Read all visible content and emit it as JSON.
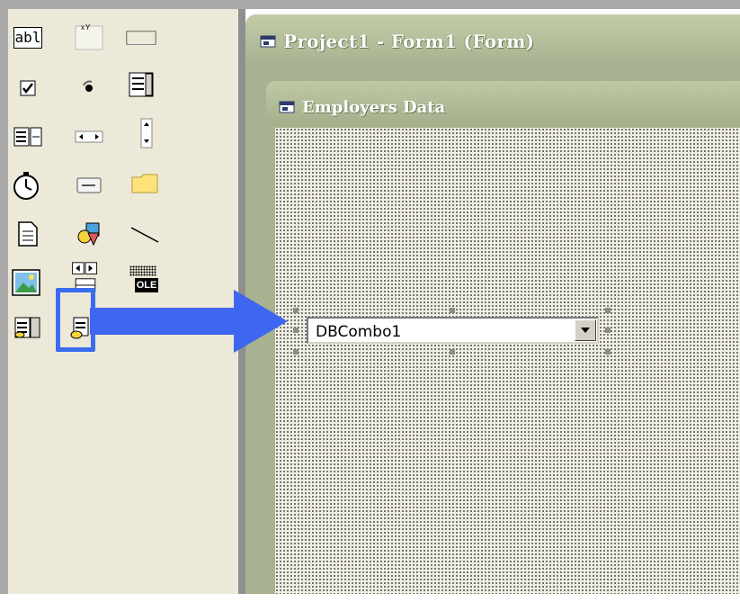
{
  "mdi_window": {
    "title": "Project1 - Form1 (Form)"
  },
  "form_window": {
    "title": "Employers Data"
  },
  "combo": {
    "value": "DBCombo1"
  },
  "toolbox": {
    "textbox_icon_text": "abl",
    "ole_icon_text": "OLE",
    "items": [
      "textbox-icon",
      "label-icon",
      "frame-icon",
      "checkbox-icon",
      "option-button-icon",
      "listbox-icon",
      "combobox-icon",
      "hscrollbar-icon",
      "vscrollbar-icon",
      "timer-icon",
      "drive-listbox-icon",
      "dir-listbox-icon",
      "file-listbox-icon",
      "shape-icon",
      "line-icon",
      "image-icon",
      "data-control-icon",
      "ole-icon",
      "dblist-icon",
      "dbcombo-icon"
    ]
  },
  "colors": {
    "highlight": "#3a6cf0",
    "arrow": "#3f66f0",
    "title_bar": "#a7b390",
    "toolbox_bg": "#ece9d8"
  }
}
